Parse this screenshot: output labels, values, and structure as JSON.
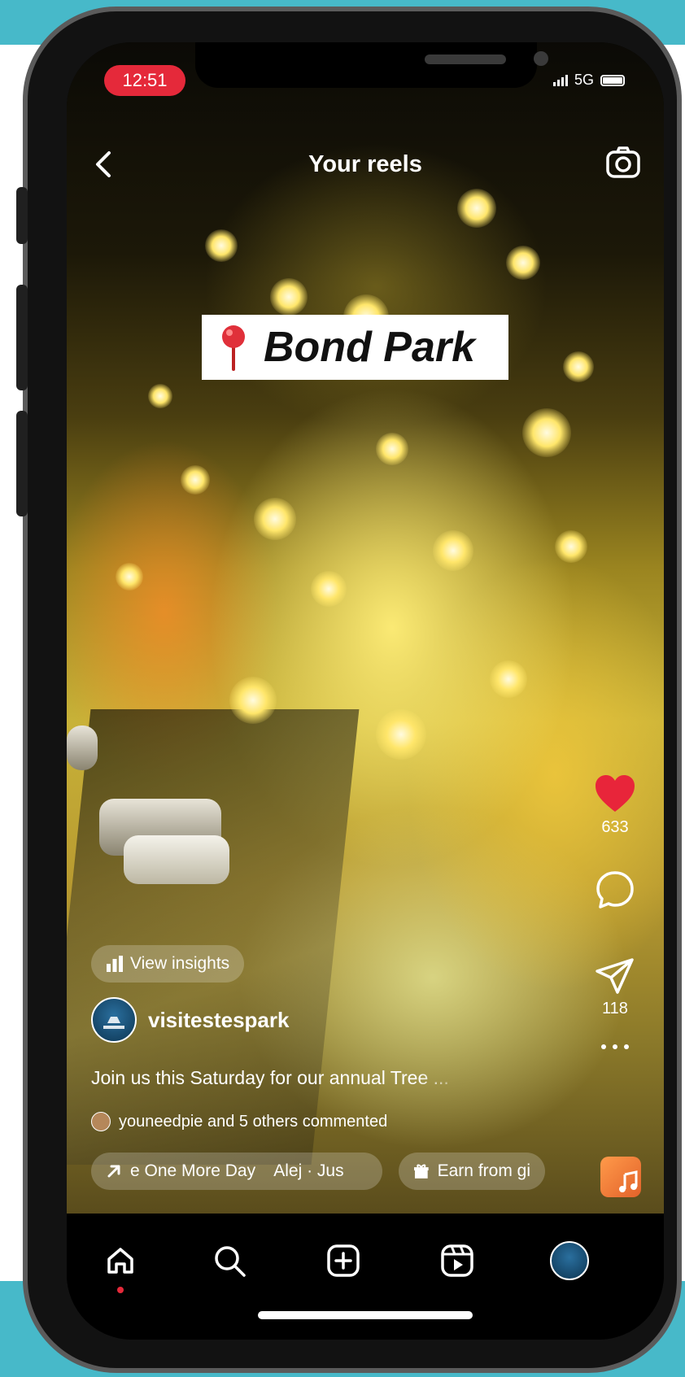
{
  "status_bar": {
    "time": "12:51",
    "network": "5G"
  },
  "header": {
    "title": "Your reels",
    "back_icon": "chevron-left-icon",
    "camera_icon": "camera-icon"
  },
  "sticker": {
    "location": "Bond Park",
    "icon": "location-pin-icon"
  },
  "actions": {
    "likes": "633",
    "shares": "118",
    "like_color": "#e8253a"
  },
  "post": {
    "insights_label": "View insights",
    "username": "visitestespark",
    "caption": "Join us this Saturday for our annual Tree ...",
    "commented": "youneedpie and 5 others commented"
  },
  "chips": {
    "audio": "e One More Day    Alej · Jus",
    "earn": "Earn from gi"
  },
  "nav": {
    "items": [
      "home-icon",
      "search-icon",
      "create-icon",
      "reels-icon",
      "profile-avatar"
    ]
  },
  "colors": {
    "background": "#47b9c9",
    "status_pill": "#e5293a"
  }
}
